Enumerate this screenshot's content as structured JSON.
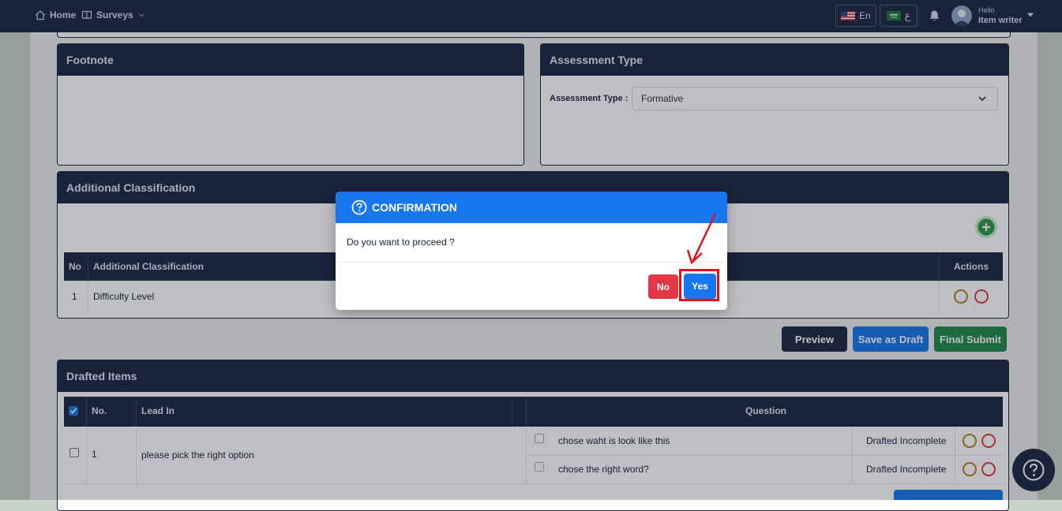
{
  "topbar": {
    "home_label": "Home",
    "surveys_label": "Surveys",
    "lang_en": "En",
    "lang_ar": "ع",
    "greeting": "Hello",
    "username": "Item writer"
  },
  "footnote": {
    "title": "Footnote"
  },
  "assessment": {
    "title": "Assessment Type",
    "field_label": "Assessment Type :",
    "selected": "Formative"
  },
  "classification": {
    "title": "Additional Classification",
    "columns": {
      "no": "No",
      "name": "Additional Classification",
      "actions": "Actions"
    },
    "rows": [
      {
        "no": "1",
        "name": "Difficulty Level"
      }
    ]
  },
  "actions": {
    "preview": "Preview",
    "save_draft": "Save as Draft",
    "final_submit": "Final Submit"
  },
  "drafted": {
    "title": "Drafted Items",
    "columns": {
      "no": "No.",
      "lead_in": "Lead In",
      "question": "Question"
    },
    "rows": [
      {
        "no": "1",
        "lead_in": "please pick the right option",
        "questions": [
          {
            "text": "chose waht is look like this",
            "status": "Drafted Incomplete"
          },
          {
            "text": "chose the right word?",
            "status": "Drafted Incomplete"
          }
        ]
      }
    ]
  },
  "modal": {
    "title": "CONFIRMATION",
    "message": "Do you want to proceed ?",
    "no_label": "No",
    "yes_label": "Yes"
  },
  "colors": {
    "navy": "#1b2743",
    "blue": "#1677ee",
    "green": "#1e8a4c",
    "red": "#e23744",
    "annotation_red": "#e0141c"
  }
}
